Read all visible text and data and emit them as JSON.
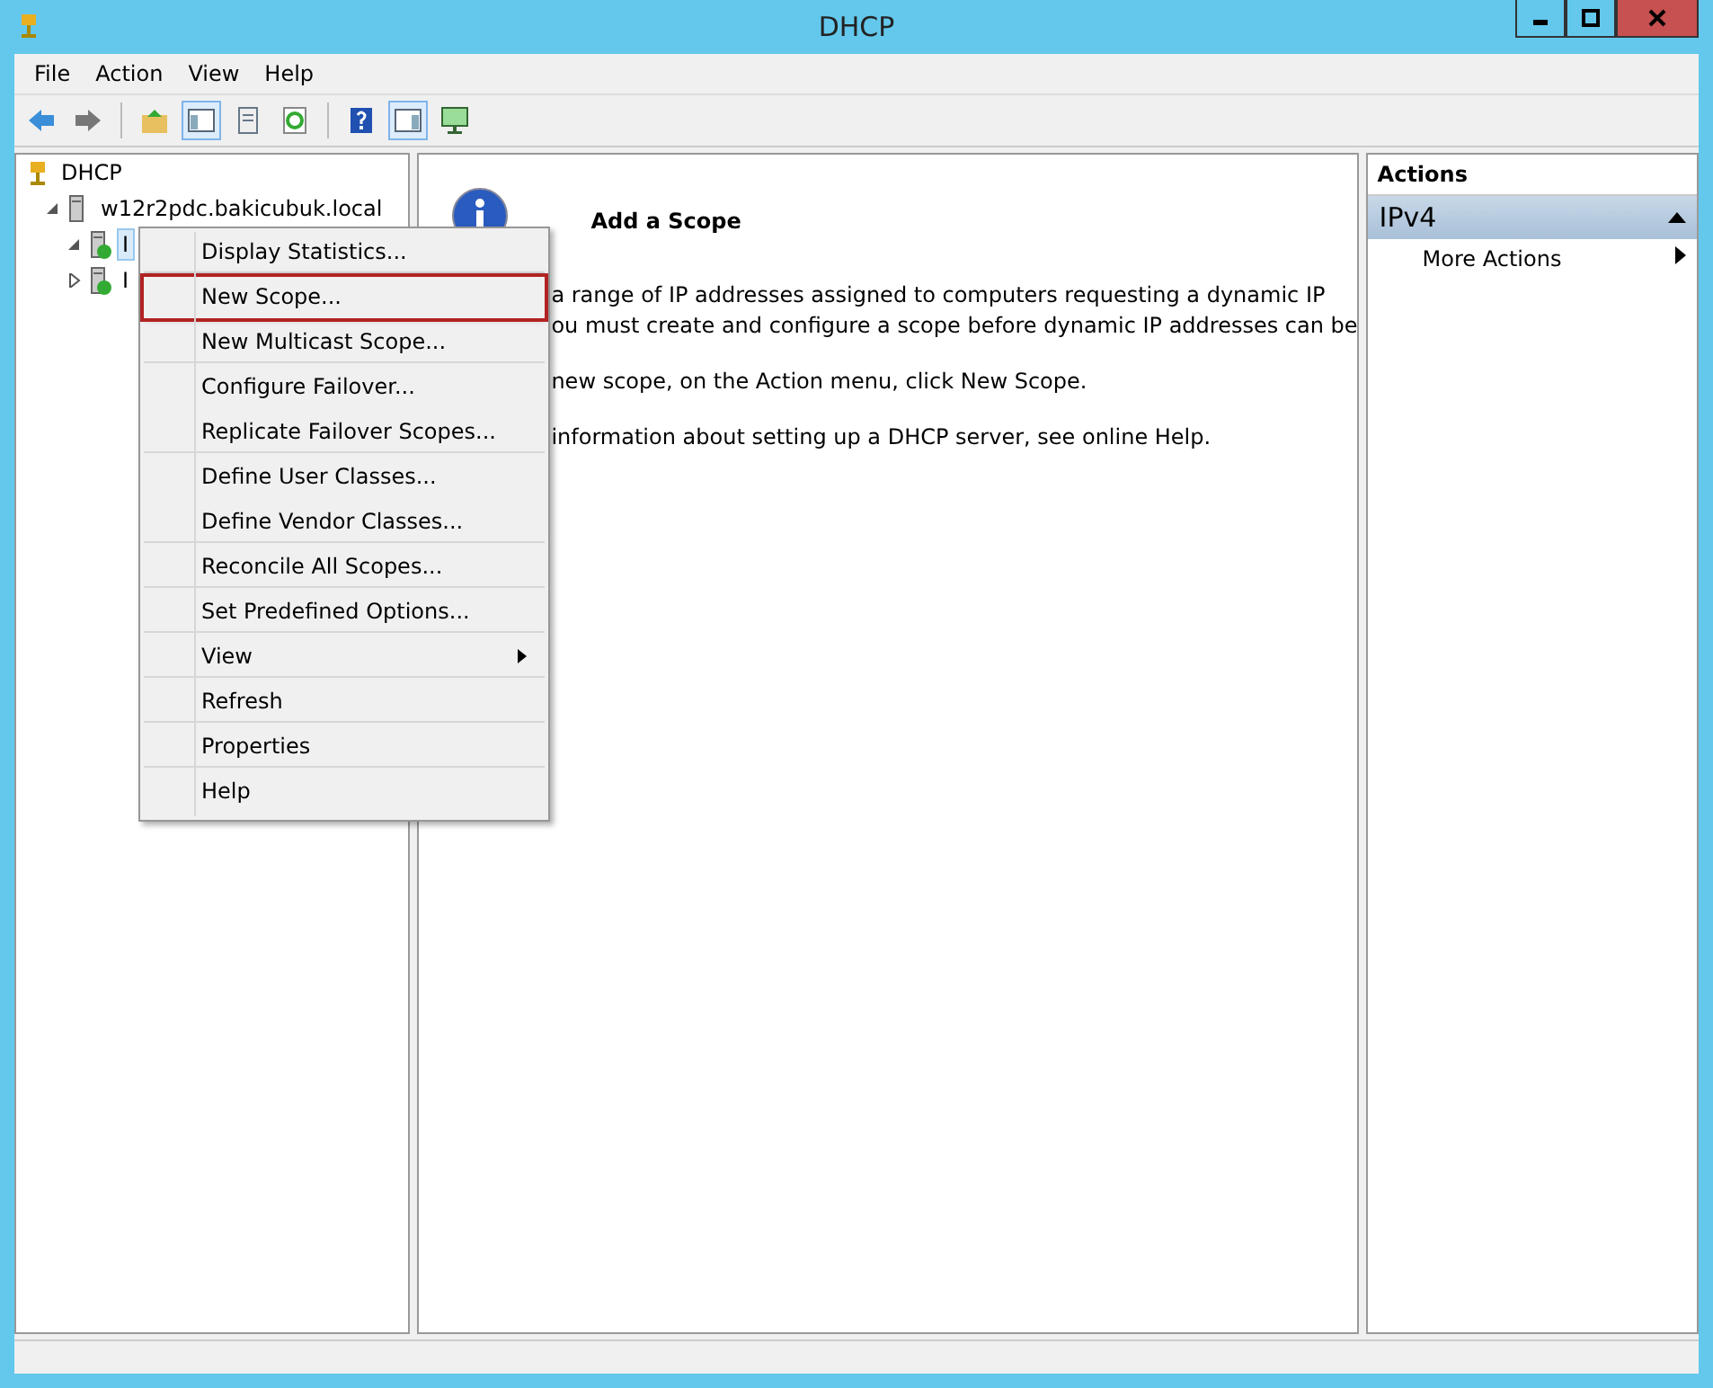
{
  "window": {
    "title": "DHCP"
  },
  "menu_bar": [
    "File",
    "Action",
    "View",
    "Help"
  ],
  "tree": [
    {
      "label": "DHCP",
      "kind": "root",
      "children": [
        {
          "label": "w12r2pdc.bakicubuk.local",
          "kind": "server",
          "expanded": true,
          "children": [
            {
              "label": "I",
              "kind": "scope",
              "expanded": true,
              "selected": true
            },
            {
              "label": "I",
              "kind": "scope",
              "expanded": false,
              "selected": false
            }
          ]
        }
      ]
    }
  ],
  "content": {
    "title": "Add a Scope",
    "paragraphs": [
      "a range of IP addresses assigned to computers requesting a dynamic IP\nou must create and configure a scope before dynamic IP addresses can be",
      "new scope, on the Action menu, click New Scope.",
      "information about setting up a DHCP server, see online Help."
    ]
  },
  "actions": {
    "header": "Actions",
    "section": "IPv4",
    "items": [
      {
        "label": "More Actions",
        "submenu": true
      }
    ]
  },
  "context_menu": [
    {
      "label": "Display Statistics...",
      "highlighted": false,
      "submenu": false,
      "group_end": true
    },
    {
      "label": "New Scope...",
      "highlighted": true,
      "submenu": false,
      "group_end": false
    },
    {
      "label": "New Multicast Scope...",
      "highlighted": false,
      "submenu": false,
      "group_end": true
    },
    {
      "label": "Configure Failover...",
      "highlighted": false,
      "submenu": false,
      "group_end": false
    },
    {
      "label": "Replicate Failover Scopes...",
      "highlighted": false,
      "submenu": false,
      "group_end": true
    },
    {
      "label": "Define User Classes...",
      "highlighted": false,
      "submenu": false,
      "group_end": false
    },
    {
      "label": "Define Vendor Classes...",
      "highlighted": false,
      "submenu": false,
      "group_end": true
    },
    {
      "label": "Reconcile All Scopes...",
      "highlighted": false,
      "submenu": false,
      "group_end": true
    },
    {
      "label": "Set Predefined Options...",
      "highlighted": false,
      "submenu": false,
      "group_end": true
    },
    {
      "label": "View",
      "highlighted": false,
      "submenu": true,
      "group_end": true
    },
    {
      "label": "Refresh",
      "highlighted": false,
      "submenu": false,
      "group_end": true
    },
    {
      "label": "Properties",
      "highlighted": false,
      "submenu": false,
      "group_end": true
    },
    {
      "label": "Help",
      "highlighted": false,
      "submenu": false,
      "group_end": false
    }
  ]
}
